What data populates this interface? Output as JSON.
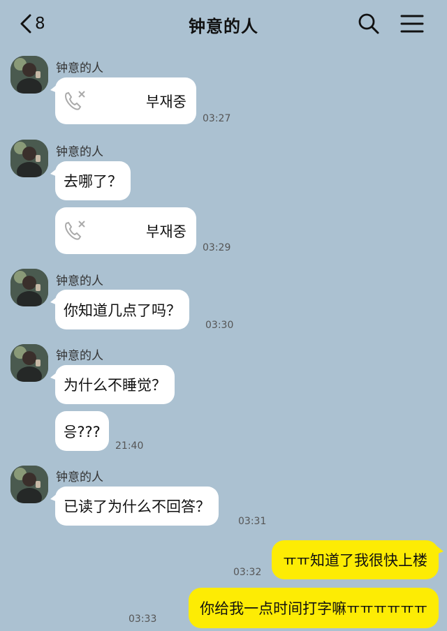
{
  "header": {
    "unread_count": "8",
    "title": "钟意的人"
  },
  "messages": [
    {
      "sender": "钟意的人",
      "type": "missed-call",
      "text": "부재중",
      "time": "03:27"
    },
    {
      "sender": "钟意的人",
      "type": "text",
      "text": "去哪了？",
      "time": ""
    },
    {
      "sender": "",
      "type": "missed-call",
      "text": "부재중",
      "time": "03:29"
    },
    {
      "sender": "钟意的人",
      "type": "text",
      "text": "你知道几点了吗？",
      "time": "03:30"
    },
    {
      "sender": "钟意的人",
      "type": "text",
      "text": "为什么不睡觉？",
      "time": ""
    },
    {
      "sender": "",
      "type": "text",
      "text": "응???",
      "time": "21:40"
    },
    {
      "sender": "钟意的人",
      "type": "text",
      "text": "已读了为什么不回答？",
      "time": "03:31"
    },
    {
      "sender": "me",
      "type": "text",
      "text": "ㅠㅠ知道了我很快上楼",
      "time": "03:32"
    },
    {
      "sender": "me",
      "type": "text",
      "text": "你给我一点时间打字嘛ㅠㅠㅠㅠㅠㅠ",
      "time": "03:33"
    }
  ],
  "colors": {
    "background": "#abc1d1",
    "my_bubble": "#fdec04",
    "their_bubble": "#ffffff"
  },
  "icons": [
    "back-chevron-icon",
    "search-icon",
    "menu-icon",
    "missed-call-icon"
  ]
}
